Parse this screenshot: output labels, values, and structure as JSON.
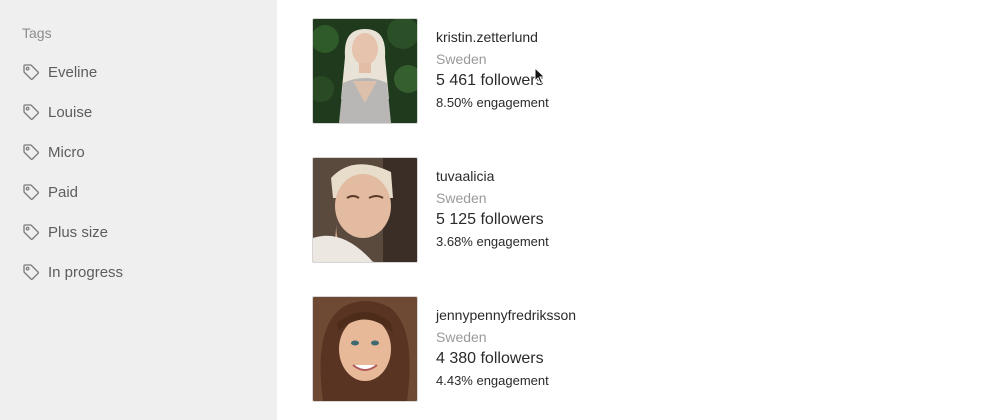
{
  "sidebar": {
    "title": "Tags",
    "items": [
      {
        "label": "Eveline",
        "icon": "tag-icon"
      },
      {
        "label": "Louise",
        "icon": "tag-icon"
      },
      {
        "label": "Micro",
        "icon": "tag-icon"
      },
      {
        "label": "Paid",
        "icon": "tag-icon"
      },
      {
        "label": "Plus size",
        "icon": "tag-icon"
      },
      {
        "label": "In progress",
        "icon": "tag-icon"
      }
    ]
  },
  "influencers": [
    {
      "username": "kristin.zetterlund",
      "country": "Sweden",
      "followers": "5 461 followers",
      "engagement": "8.50% engagement"
    },
    {
      "username": "tuvaalicia",
      "country": "Sweden",
      "followers": "5 125 followers",
      "engagement": "3.68% engagement"
    },
    {
      "username": "jennypennyfredriksson",
      "country": "Sweden",
      "followers": "4 380 followers",
      "engagement": "4.43% engagement"
    }
  ],
  "colors": {
    "sidebar_bg": "#efefef",
    "muted_text": "#9a9a9a",
    "main_text": "#2a2a2a"
  }
}
